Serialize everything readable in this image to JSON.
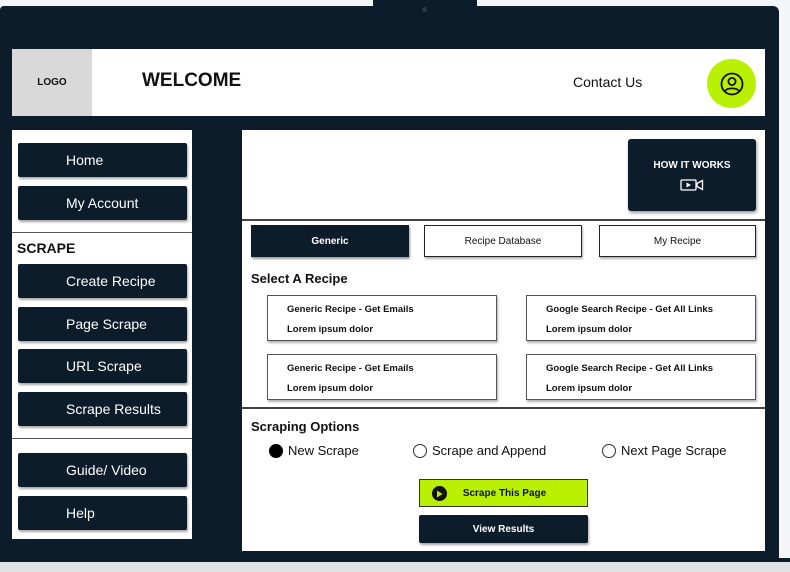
{
  "header": {
    "logo": "LOGO",
    "title": "WELCOME",
    "contact": "Contact Us"
  },
  "sidebar": {
    "top_items": [
      "Home",
      "My Account"
    ],
    "scrape_heading": "SCRAPE",
    "scrape_items": [
      "Create Recipe",
      "Page Scrape",
      "URL Scrape",
      "Scrape Results"
    ],
    "bottom_items": [
      "Guide/ Video",
      "Help"
    ]
  },
  "main": {
    "how_it_works": "HOW IT WORKS",
    "tabs": [
      {
        "label": "Generic",
        "active": true
      },
      {
        "label": "Recipe Database",
        "active": false
      },
      {
        "label": "My Recipe",
        "active": false
      }
    ],
    "select_title": "Select A Recipe",
    "recipes": [
      {
        "title": "Generic Recipe - Get Emails",
        "desc": "Lorem ipsum dolor"
      },
      {
        "title": "Google Search Recipe - Get All Links",
        "desc": "Lorem ipsum dolor"
      },
      {
        "title": "Generic Recipe - Get Emails",
        "desc": "Lorem ipsum dolor"
      },
      {
        "title": "Google Search Recipe - Get All Links",
        "desc": "Lorem ipsum dolor"
      }
    ],
    "options_title": "Scraping Options",
    "options": [
      {
        "label": "New Scrape",
        "selected": true
      },
      {
        "label": "Scrape and Append",
        "selected": false
      },
      {
        "label": "Next Page Scrape",
        "selected": false
      }
    ],
    "scrape_button": "Scrape This Page",
    "view_button": "View Results"
  },
  "colors": {
    "navy": "#0c1c2b",
    "accent": "#b8f000"
  }
}
